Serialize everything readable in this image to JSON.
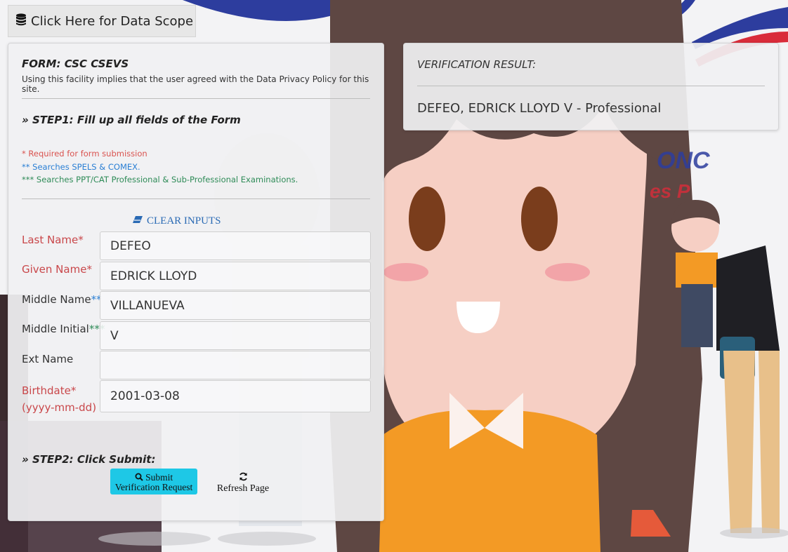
{
  "scope_button": {
    "label": "Click Here for Data Scope",
    "icon": "database-icon"
  },
  "form": {
    "title": "FORM: CSC CSEVS",
    "privacy_notice": "Using this facility implies that the user agreed with the Data Privacy Policy for this site.",
    "step1": "» STEP1: Fill up all fields of the Form",
    "notes": {
      "required": "* Required for form submission",
      "spels": "** Searches SPELS & COMEX.",
      "ppt": "*** Searches PPT/CAT Professional & Sub-Professional Examinations."
    },
    "clear_button": {
      "label": "CLEAR INPUTS",
      "icon": "eraser-icon"
    },
    "fields": {
      "last_name": {
        "label": "Last Name",
        "marker": "*",
        "value": "DEFEO"
      },
      "given_name": {
        "label": "Given Name",
        "marker": "*",
        "value": "EDRICK LLOYD"
      },
      "middle_name": {
        "label": "Middle Name",
        "marker": "**",
        "value": "VILLANUEVA"
      },
      "middle_initial": {
        "label": "Middle Initial",
        "marker": "***",
        "value": "V"
      },
      "ext_name": {
        "label": "Ext Name",
        "value": ""
      },
      "birthdate": {
        "label": "Birthdate*",
        "format": "(yyyy-mm-dd)",
        "value": "2001-03-08"
      }
    },
    "step2": "» STEP2: Click Submit:",
    "submit_button": {
      "line1": "Submit",
      "line2": "Verification Request",
      "icon": "search-icon"
    },
    "refresh_button": {
      "label": "Refresh Page",
      "icon": "refresh-icon"
    }
  },
  "result": {
    "title": "VERIFICATION RESULT:",
    "value": "DEFEO, EDRICK LLOYD V - Professional"
  },
  "colors": {
    "required": "#c9474a",
    "blue_note": "#2a7fd4",
    "green_note": "#2e8b57",
    "submit_bg": "#1ec8e6",
    "link": "#2a6ab4"
  }
}
